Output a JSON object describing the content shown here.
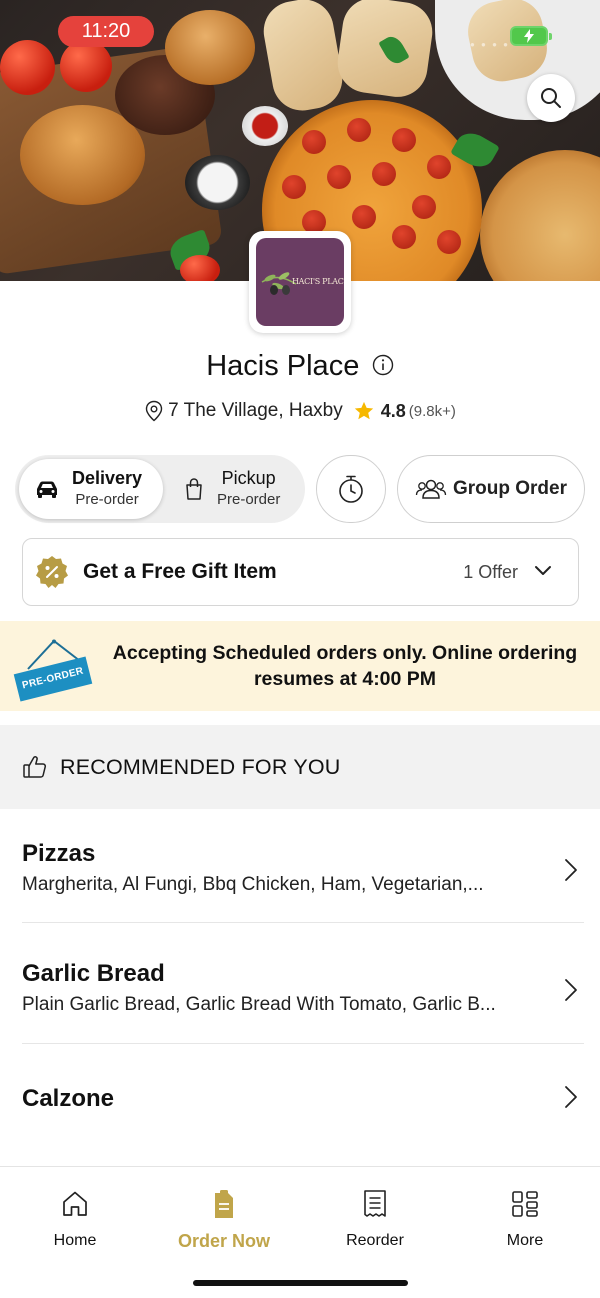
{
  "status_bar": {
    "time": "11:20"
  },
  "restaurant": {
    "logo_text": "HACI'S PLACE",
    "name": "Hacis Place",
    "address": "7 The Village, Haxby",
    "rating": "4.8",
    "rating_count": "(9.8k+)"
  },
  "order_mode": {
    "delivery": {
      "label": "Delivery",
      "sub": "Pre-order"
    },
    "pickup": {
      "label": "Pickup",
      "sub": "Pre-order"
    },
    "group_order_label": "Group Order"
  },
  "offer": {
    "title": "Get a Free Gift Item",
    "count": "1 Offer"
  },
  "banner": {
    "sign_text": "PRE-ORDER",
    "message": "Accepting Scheduled orders only. Online ordering resumes at 4:00 PM"
  },
  "recommended": {
    "header": "RECOMMENDED FOR YOU",
    "categories": [
      {
        "name": "Pizzas",
        "items": "Margherita, Al Fungi, Bbq Chicken, Ham, Vegetarian,..."
      },
      {
        "name": "Garlic Bread",
        "items": "Plain Garlic Bread, Garlic Bread With Tomato, Garlic B..."
      },
      {
        "name": "Calzone",
        "items": ""
      }
    ]
  },
  "tabbar": {
    "tabs": [
      {
        "label": "Home",
        "icon": "home-icon"
      },
      {
        "label": "Order Now",
        "icon": "order-bag-icon"
      },
      {
        "label": "Reorder",
        "icon": "receipt-icon"
      },
      {
        "label": "More",
        "icon": "grid-icon"
      }
    ]
  },
  "colors": {
    "accent_gold": "#c0a54a",
    "status_red": "#e5423c",
    "banner_bg": "#fdf4dc",
    "star_yellow": "#f6b800"
  }
}
